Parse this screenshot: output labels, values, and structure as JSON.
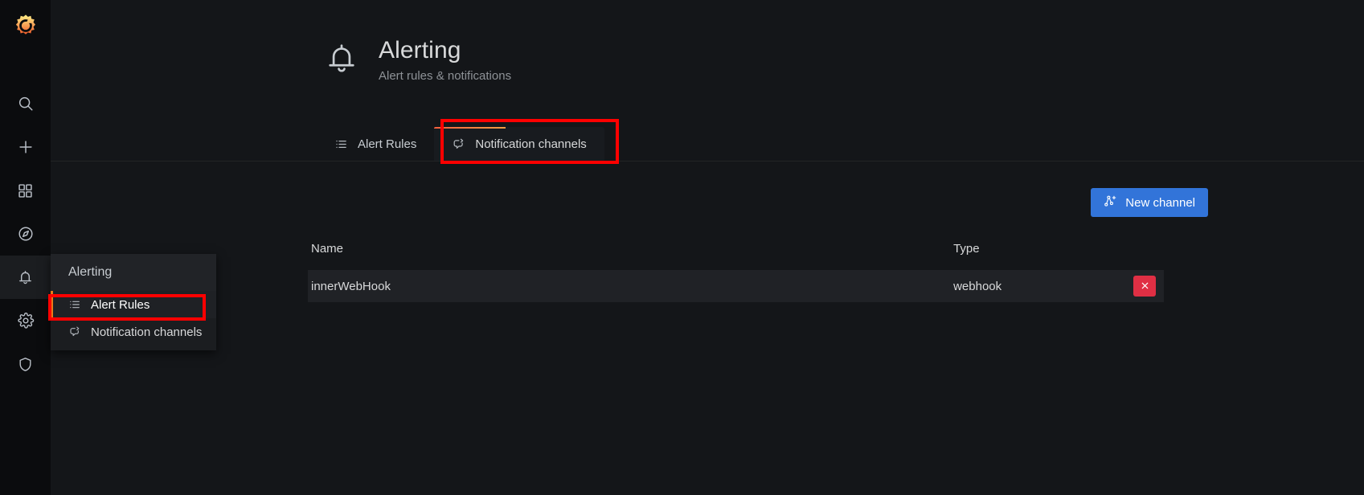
{
  "sidebar": {
    "brand_icon": "grafana-logo-icon",
    "items": [
      {
        "name": "search",
        "icon": "search-icon",
        "active": false
      },
      {
        "name": "create",
        "icon": "plus-icon",
        "active": false
      },
      {
        "name": "dashboards",
        "icon": "apps-grid-icon",
        "active": false
      },
      {
        "name": "explore",
        "icon": "compass-icon",
        "active": false
      },
      {
        "name": "alerting",
        "icon": "bell-icon",
        "active": true
      },
      {
        "name": "configuration",
        "icon": "gear-icon",
        "active": false
      },
      {
        "name": "server-admin",
        "icon": "shield-icon",
        "active": false
      }
    ]
  },
  "header": {
    "icon": "bell-icon",
    "title": "Alerting",
    "subtitle": "Alert rules & notifications"
  },
  "tabs": [
    {
      "label": "Alert Rules",
      "icon": "list-ul-icon",
      "active": false
    },
    {
      "label": "Notification channels",
      "icon": "comment-share-icon",
      "active": true
    }
  ],
  "toolbar": {
    "new_channel_label": "New channel",
    "new_channel_icon": "channel-add-icon",
    "new_channel_color": "#3274d9"
  },
  "table": {
    "columns": [
      "Name",
      "Type"
    ],
    "rows": [
      {
        "name": "innerWebHook",
        "type": "webhook",
        "delete_icon": "close-icon"
      }
    ]
  },
  "flyout": {
    "title": "Alerting",
    "items": [
      {
        "label": "Alert Rules",
        "icon": "list-ul-icon",
        "active": true
      },
      {
        "label": "Notification channels",
        "icon": "comment-share-icon",
        "active": false
      }
    ]
  },
  "annotations": {
    "highlight_color": "#ff0000",
    "tab_highlight": "Notification channels",
    "menu_highlight": "Alert Rules"
  },
  "colors": {
    "page_background": "#141619",
    "rail_background": "#0b0c0e",
    "row_background": "#202226",
    "accent_orange": "#eb7b18",
    "primary_blue": "#3274d9",
    "danger_red": "#e02f44"
  }
}
